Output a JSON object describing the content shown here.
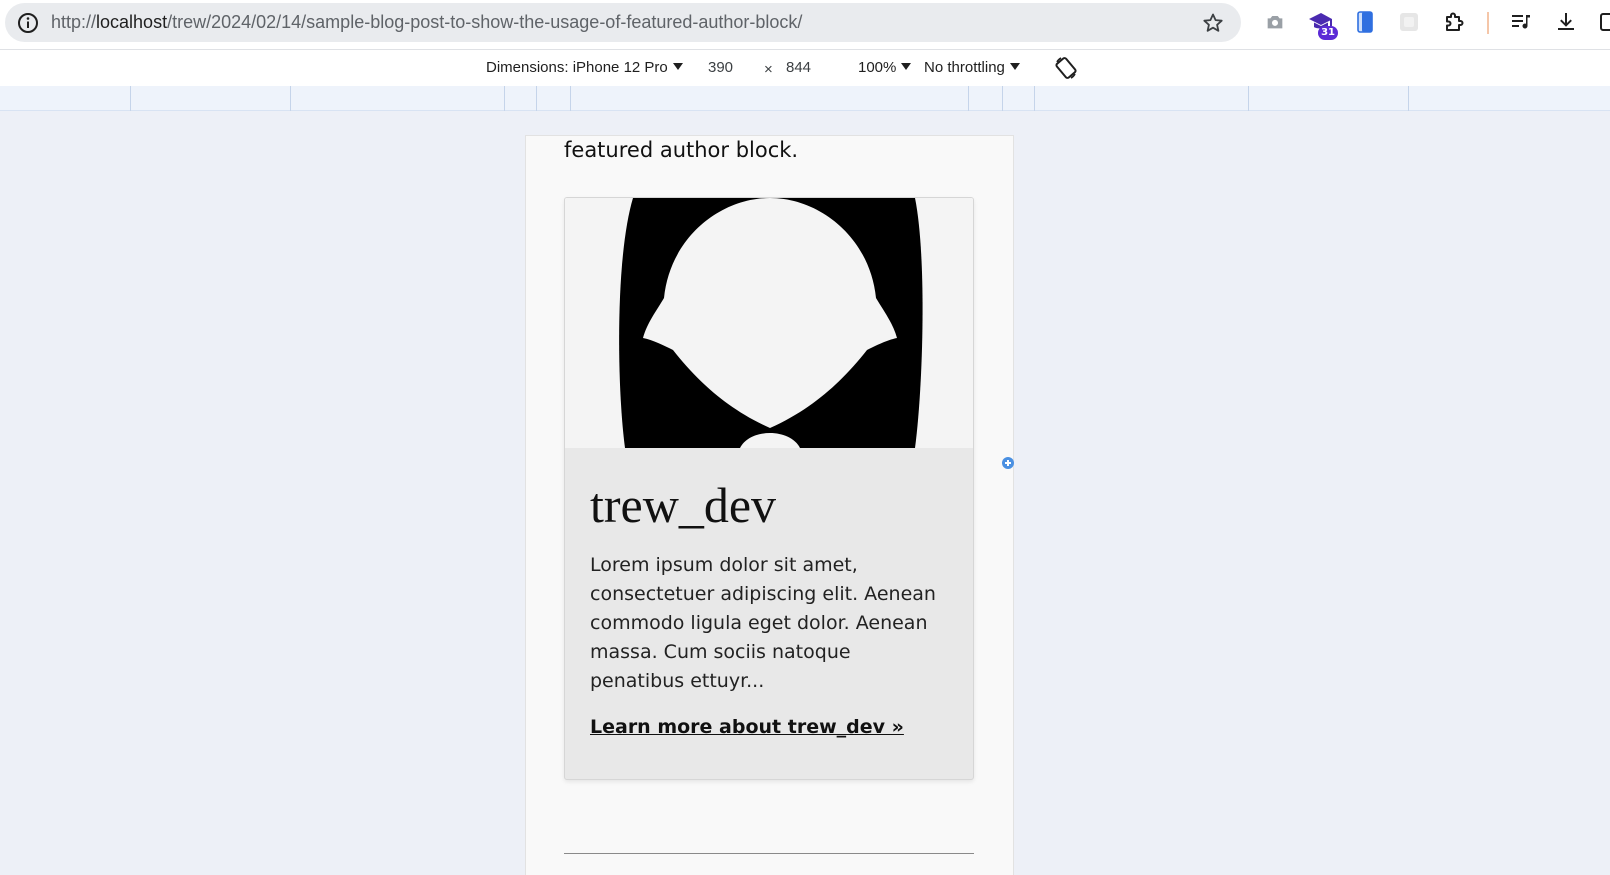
{
  "browser": {
    "url_prefix": "http://",
    "url_host": "localhost",
    "url_path": "/trew/2024/02/14/sample-blog-post-to-show-the-usage-of-featured-author-block/",
    "extension_badge": "31",
    "icons": {
      "info": "info-icon",
      "star": "star-icon",
      "camera": "camera-icon",
      "extension_cap": "graduation-cap-extension-icon",
      "phone": "phone-extension-icon",
      "puzzle": "puzzle-extensions-icon",
      "media": "media-controls-icon",
      "download": "download-icon",
      "split": "split-view-icon"
    }
  },
  "devtools": {
    "dimensions_label": "Dimensions: iPhone 12 Pro",
    "width": "390",
    "times": "×",
    "height": "844",
    "zoom": "100%",
    "throttling": "No throttling"
  },
  "page": {
    "lead_text": "featured author block.",
    "author": {
      "name": "trew_dev",
      "bio": "Lorem ipsum dolor sit amet, consectetuer adipiscing elit. Aenean commodo ligula eget dolor. Aenean massa. Cum sociis natoque penatibus ettuyr...",
      "link_text": "Learn more about trew_dev »"
    }
  },
  "colors": {
    "viewport_bg": "#edf0f7",
    "page_bg": "#f9f9f9",
    "card_bg": "#e8e8e8",
    "badge": "#5b2ad6"
  }
}
